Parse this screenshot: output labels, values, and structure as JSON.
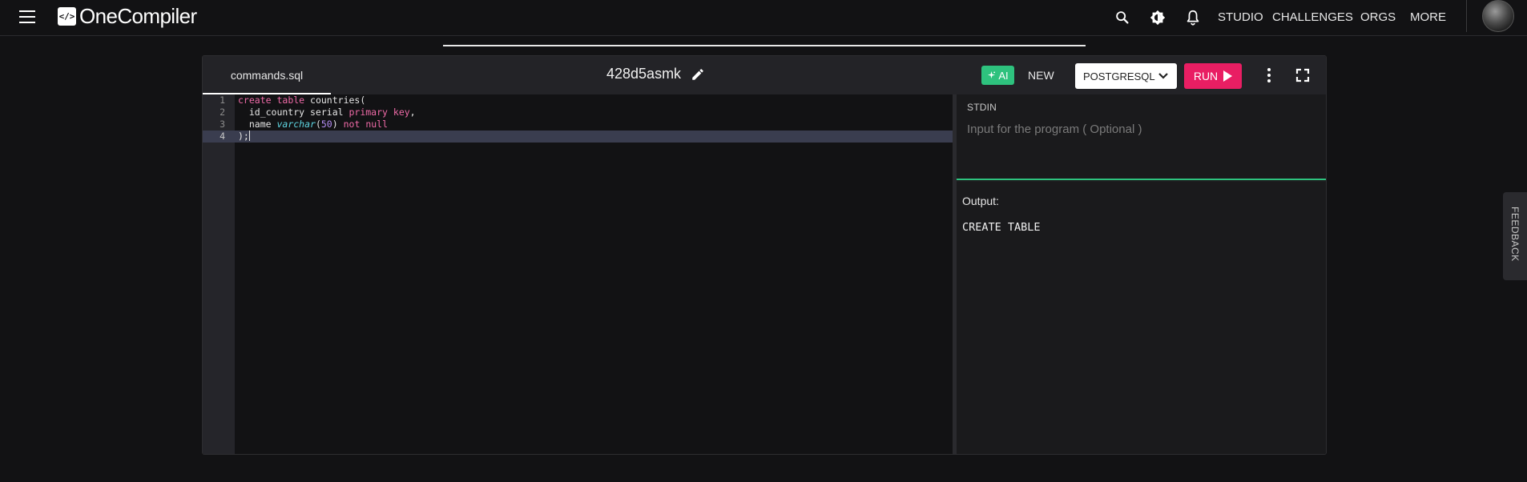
{
  "brand": {
    "name": "OneCompiler",
    "mark": "</>"
  },
  "nav": {
    "icons": [
      "search-icon",
      "theme-icon",
      "bell-icon"
    ],
    "links": [
      {
        "label": "STUDIO"
      },
      {
        "label": "CHALLENGES"
      },
      {
        "label": "ORGS"
      },
      {
        "label": "MORE"
      }
    ]
  },
  "editor": {
    "file_tab": "commands.sql",
    "title": "428d5asmk",
    "ai_label": "AI",
    "new_label": "NEW",
    "language": "POSTGRESQL",
    "run_label": "RUN",
    "line_numbers": [
      "1",
      "2",
      "3",
      "4"
    ],
    "active_line": 4,
    "code_lines": [
      "create table countries(",
      "  id_country serial primary key,",
      "  name varchar(50) not null",
      ");"
    ]
  },
  "stdin": {
    "label": "STDIN",
    "placeholder": "Input for the program ( Optional )",
    "value": ""
  },
  "output": {
    "label": "Output:",
    "text": "CREATE TABLE"
  },
  "feedback": {
    "label": "FEEDBACK"
  },
  "colors": {
    "run": "#e91e63",
    "ai": "#2ec27e",
    "keyword": "#f06ba8",
    "type": "#5fd7e3",
    "number": "#b48cf2",
    "background": "#121214"
  }
}
